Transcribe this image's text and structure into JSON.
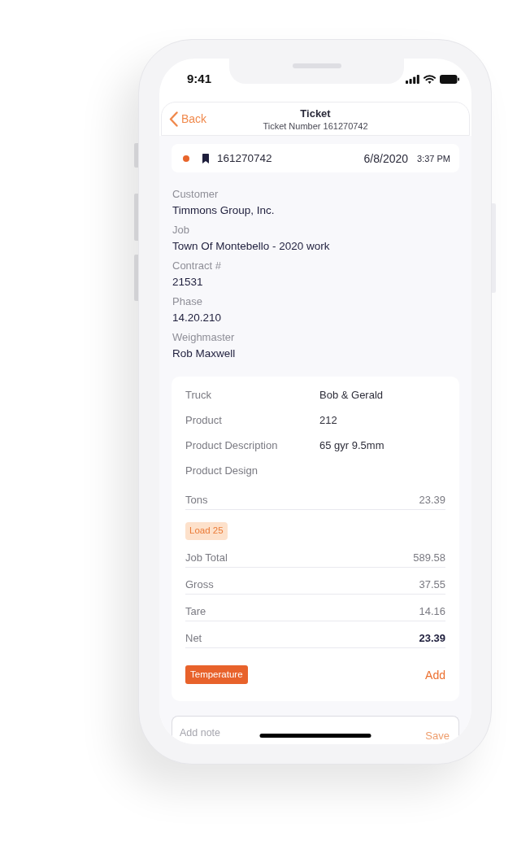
{
  "status_bar": {
    "time": "9:41"
  },
  "header": {
    "back": "Back",
    "title": "Ticket",
    "subtitle": "Ticket Number 161270742"
  },
  "ticket": {
    "number": "161270742",
    "date": "6/8/2020",
    "time": "3:37 PM"
  },
  "fields": [
    {
      "label": "Customer",
      "value": "Timmons Group, Inc."
    },
    {
      "label": "Job",
      "value": "Town Of Montebello - 2020 work"
    },
    {
      "label": "Contract #",
      "value": "21531"
    },
    {
      "label": "Phase",
      "value": "14.20.210"
    },
    {
      "label": "Weighmaster",
      "value": "Rob Maxwell"
    }
  ],
  "details": [
    {
      "label": "Truck",
      "value": "Bob & Gerald"
    },
    {
      "label": "Product",
      "value": "212"
    },
    {
      "label": "Product Description",
      "value": "65 gyr 9.5mm"
    },
    {
      "label": "Product Design"
    }
  ],
  "measurements": [
    {
      "kind": "row",
      "label": "Tons",
      "value": "23.39",
      "bold": false
    },
    {
      "kind": "badge",
      "label": "Load 25"
    },
    {
      "kind": "row",
      "label": "Job Total",
      "value": "589.58",
      "bold": false
    },
    {
      "kind": "row",
      "label": "Gross",
      "value": "37.55",
      "bold": false
    },
    {
      "kind": "row",
      "label": "Tare",
      "value": "14.16",
      "bold": false
    },
    {
      "kind": "row",
      "label": "Net",
      "value": "23.39",
      "bold": true
    }
  ],
  "temperature": {
    "label": "Temperature",
    "action": "Add"
  },
  "note": {
    "placeholder": "Add note",
    "save": "Save",
    "save_disabled": true
  }
}
